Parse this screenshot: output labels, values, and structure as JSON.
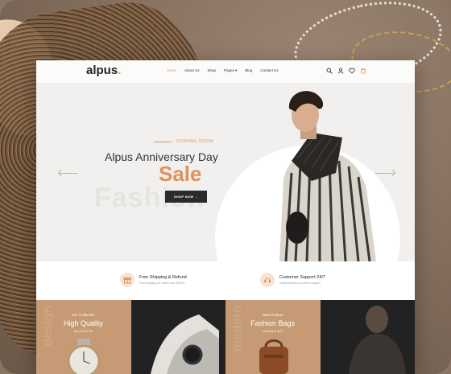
{
  "nav": {
    "logo": "alpus",
    "logo_dot": ".",
    "menu": [
      "Home",
      "About Us",
      "Shop",
      "Pages ▾",
      "Blog",
      "Contact Us"
    ],
    "icons": [
      "search-icon",
      "user-icon",
      "heart-icon",
      "cart-icon"
    ]
  },
  "hero": {
    "kicker": "COMING SOON",
    "title": "Alpus Anniversary Day",
    "sale": "Sale",
    "watermark": "Fashion",
    "button_label": "SHOP NOW  →"
  },
  "features": [
    {
      "icon": "gift-icon",
      "title": "Free Shipping & Refund",
      "subtitle": "Free shipping on orders over $99.00"
    },
    {
      "icon": "headset-icon",
      "title": "Customer Support 24/7",
      "subtitle": "Instant access to perfect support"
    }
  ],
  "categories": [
    {
      "vertical": "design",
      "kicker": "Our Collection",
      "title": "High Quality",
      "price": "from $120.00"
    },
    {
      "vertical": "",
      "kicker": "",
      "title": "",
      "price": ""
    },
    {
      "vertical": "modern",
      "kicker": "New Product",
      "title": "Fashion Bags",
      "price": "starting at $78"
    },
    {
      "vertical": "",
      "kicker": "",
      "title": "",
      "price": ""
    }
  ],
  "colors": {
    "accent": "#e0915a",
    "tan": "#c69a74",
    "dark": "#232222"
  }
}
